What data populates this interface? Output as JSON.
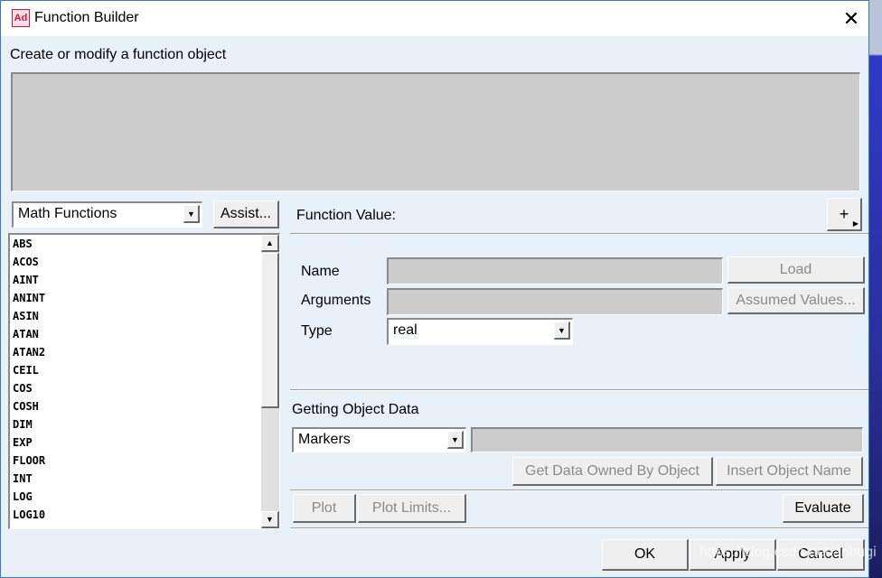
{
  "window": {
    "title": "Function Builder",
    "app_icon": "Ad",
    "close": "✕"
  },
  "header": {
    "label": "Create or modify a function object"
  },
  "category_select": {
    "value": "Math Functions"
  },
  "assist_label": "Assist...",
  "functions": [
    "ABS",
    "ACOS",
    "AINT",
    "ANINT",
    "ASIN",
    "ATAN",
    "ATAN2",
    "CEIL",
    "COS",
    "COSH",
    "DIM",
    "EXP",
    "FLOOR",
    "INT",
    "LOG",
    "LOG10"
  ],
  "function_value": {
    "label": "Function Value:",
    "plus": "+"
  },
  "form": {
    "name_label": "Name",
    "arguments_label": "Arguments",
    "type_label": "Type",
    "type_value": "real",
    "load": "Load",
    "assumed": "Assumed Values..."
  },
  "object_data": {
    "label": "Getting Object Data",
    "select_value": "Markers",
    "get_data": "Get Data Owned By Object",
    "insert_name": "Insert Object Name"
  },
  "actions": {
    "plot": "Plot",
    "plot_limits": "Plot Limits...",
    "evaluate": "Evaluate",
    "ok": "OK",
    "apply": "Apply",
    "cancel": "Cancel"
  },
  "watermark": "https://blog.csdn.net/anbugi"
}
